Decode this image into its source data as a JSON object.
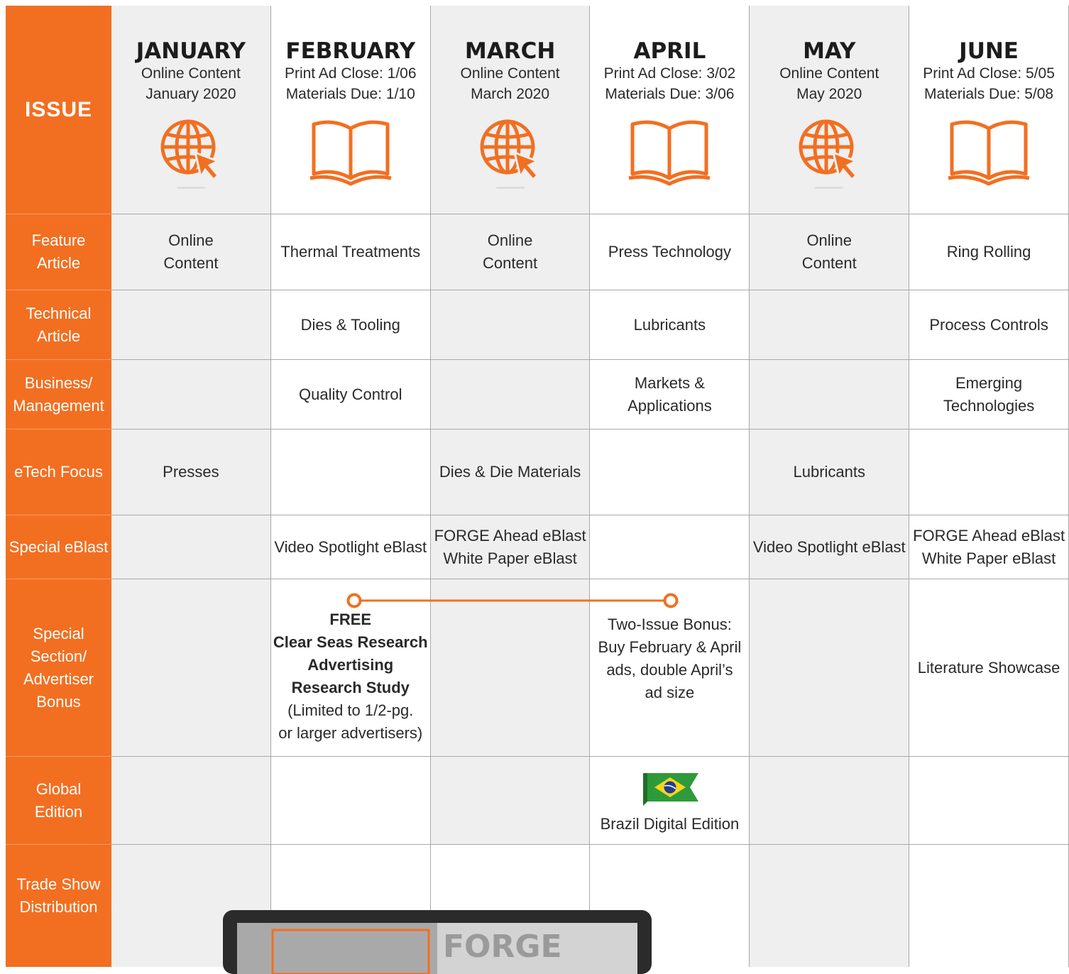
{
  "issue_label": "ISSUE",
  "months": [
    {
      "name": "JANUARY",
      "line1": "Online Content",
      "line2": "January 2020",
      "icon": "globe-cursor-icon"
    },
    {
      "name": "FEBRUARY",
      "line1": "Print Ad Close: 1/06",
      "line2": "Materials Due: 1/10",
      "icon": "open-book-icon"
    },
    {
      "name": "MARCH",
      "line1": "Online Content",
      "line2": "March 2020",
      "icon": "globe-cursor-icon"
    },
    {
      "name": "APRIL",
      "line1": "Print Ad Close: 3/02",
      "line2": "Materials Due: 3/06",
      "icon": "open-book-icon"
    },
    {
      "name": "MAY",
      "line1": "Online Content",
      "line2": "May 2020",
      "icon": "globe-cursor-icon"
    },
    {
      "name": "JUNE",
      "line1": "Print Ad Close: 5/05",
      "line2": "Materials Due: 5/08",
      "icon": "open-book-icon"
    }
  ],
  "rows": {
    "feature": {
      "label_1": "Feature",
      "label_2": "Article",
      "jan_1": "Online",
      "jan_2": "Content",
      "feb": "Thermal Treatments",
      "mar_1": "Online",
      "mar_2": "Content",
      "apr": "Press Technology",
      "may_1": "Online",
      "may_2": "Content",
      "jun": "Ring Rolling"
    },
    "technical": {
      "label_1": "Technical",
      "label_2": "Article",
      "feb": "Dies & Tooling",
      "apr": "Lubricants",
      "jun": "Process Controls"
    },
    "business": {
      "label_1": "Business/",
      "label_2": "Management",
      "feb": "Quality Control",
      "apr_1": "Markets &",
      "apr_2": "Applications",
      "jun_1": "Emerging",
      "jun_2": "Technologies"
    },
    "etech": {
      "label": "eTech Focus",
      "jan": "Presses",
      "mar": "Dies & Die Materials",
      "may": "Lubricants"
    },
    "eblast": {
      "label": "Special eBlast",
      "feb": "Video Spotlight eBlast",
      "mar_1": "FORGE Ahead eBlast",
      "mar_2": "White Paper eBlast",
      "may": "Video Spotlight eBlast",
      "jun_1": "FORGE Ahead eBlast",
      "jun_2": "White Paper eBlast"
    },
    "special": {
      "label_1": "Special",
      "label_2": "Section/",
      "label_3": "Advertiser",
      "label_4": "Bonus",
      "feb_1": "FREE",
      "feb_2": "Clear Seas Research",
      "feb_3": "Advertising",
      "feb_4": "Research Study",
      "feb_5": "(Limited to 1/2-pg.",
      "feb_6": "or larger advertisers)",
      "apr_1": "Two-Issue Bonus:",
      "apr_2": "Buy February & April",
      "apr_3": "ads, double April’s",
      "apr_4": "ad size",
      "jun": "Literature Showcase"
    },
    "global": {
      "label_1": "Global",
      "label_2": "Edition",
      "apr": "Brazil Digital Edition",
      "flag_icon": "brazil-flag-icon"
    },
    "tradeshow": {
      "label_1": "Trade Show",
      "label_2": "Distribution",
      "monitor_icon": "forge-magazine-monitor-icon"
    }
  },
  "colors": {
    "accent": "#f26f21",
    "grey": "#efefef"
  },
  "monitor_text": "FORGE"
}
